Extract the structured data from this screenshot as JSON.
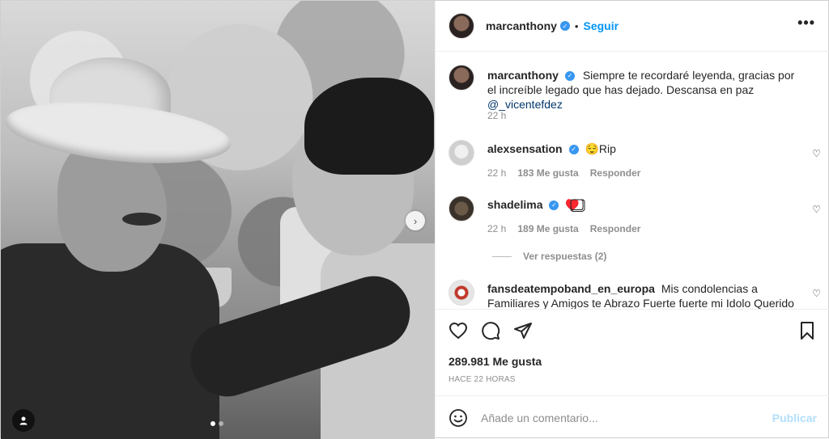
{
  "header": {
    "username": "marcanthony",
    "separator": "•",
    "follow_label": "Seguir",
    "more_label": "•••"
  },
  "caption": {
    "username": "marcanthony",
    "text": "Siempre te recordaré leyenda, gracias por el increíble legado que has dejado. Descansa en paz",
    "mention": "@_vicentefdez",
    "time": "22 h"
  },
  "comments": [
    {
      "username": "alexsensation",
      "text": "😌Rip",
      "time": "22 h",
      "likes": "183 Me gusta",
      "reply_label": "Responder"
    },
    {
      "username": "shadelima",
      "text": "♥️⃣⃣",
      "time": "22 h",
      "likes": "189 Me gusta",
      "reply_label": "Responder",
      "replies_label": "Ver respuestas (2)"
    },
    {
      "username": "fansdeatempoband_en_europa",
      "text": "Mis condolencias a Familiares y Amigos te Abrazo Fuerte fuerte mi Idolo Querido ⃣⃣⃣"
    }
  ],
  "post": {
    "likes": "289.981 Me gusta",
    "time_ago": "HACE 22 HORAS",
    "carousel_count": 2,
    "carousel_active": 0
  },
  "add_comment": {
    "placeholder": "Añade un comentario...",
    "publish_label": "Publicar"
  },
  "icons": {
    "like": "heart-icon",
    "comment": "comment-icon",
    "share": "share-icon",
    "save": "bookmark-icon",
    "emoji": "emoji-icon",
    "next": "chevron-right-icon",
    "tag": "user-tag-icon"
  },
  "colors": {
    "accent": "#0095f6",
    "publish_disabled": "#b2dffc",
    "muted": "#8e8e8e",
    "verified": "#3897f0"
  }
}
